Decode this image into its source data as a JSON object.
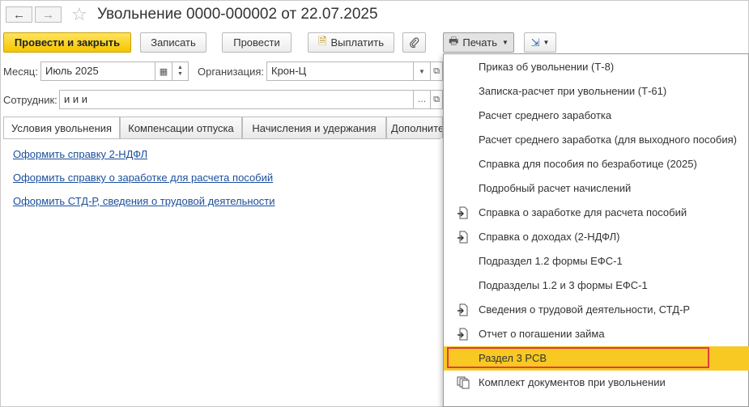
{
  "window": {
    "title": "Увольнение 0000-000002 от 22.07.2025",
    "back_icon": "←",
    "forward_icon": "→",
    "favorite_icon": "☆"
  },
  "toolbar": {
    "post_close": "Провести и закрыть",
    "save": "Записать",
    "post": "Провести",
    "pay": "Выплатить",
    "print": "Печать",
    "print_icon": "🖶",
    "pay_icon": "🗎",
    "attach_icon": "⚲",
    "create_based_icon": "⇲"
  },
  "form": {
    "month_label": "Месяц:",
    "month_value": "Июль 2025",
    "org_label": "Организация:",
    "org_value": "Крон-Ц",
    "employee_label": "Сотрудник:",
    "employee_value": "и и и"
  },
  "tabs": [
    {
      "label": "Условия увольнения"
    },
    {
      "label": "Компенсации отпуска"
    },
    {
      "label": "Начисления и удержания"
    },
    {
      "label": "Дополнительно"
    }
  ],
  "links": [
    {
      "text": "Оформить справку 2-НДФЛ"
    },
    {
      "text": "Оформить справку о заработке для расчета пособий"
    },
    {
      "text": "Оформить СТД-Р, сведения о трудовой деятельности"
    }
  ],
  "print_menu": {
    "highlight_color": "#f8c823",
    "items": [
      {
        "label": "Приказ об увольнении (Т-8)",
        "icon": ""
      },
      {
        "label": "Записка-расчет при увольнении (Т-61)",
        "icon": ""
      },
      {
        "label": "Расчет среднего заработка",
        "icon": ""
      },
      {
        "label": "Расчет среднего заработка (для выходного пособия)",
        "icon": ""
      },
      {
        "label": "Справка для пособия по безработице (2025)",
        "icon": ""
      },
      {
        "label": "Подробный расчет начислений",
        "icon": ""
      },
      {
        "label": "Справка о заработке для расчета пособий",
        "icon": "export-document-icon"
      },
      {
        "label": "Справка о доходах (2-НДФЛ)",
        "icon": "export-document-icon"
      },
      {
        "label": "Подраздел 1.2 формы ЕФС-1",
        "icon": ""
      },
      {
        "label": "Подразделы 1.2 и 3 формы ЕФС-1",
        "icon": ""
      },
      {
        "label": "Сведения о трудовой деятельности, СТД-Р",
        "icon": "export-document-icon"
      },
      {
        "label": "Отчет о погашении займа",
        "icon": "export-document-icon"
      },
      {
        "label": "Раздел 3 РСВ",
        "icon": "",
        "selected": true
      },
      {
        "label": "Комплект документов при увольнении",
        "icon": "document-set-icon"
      }
    ]
  }
}
